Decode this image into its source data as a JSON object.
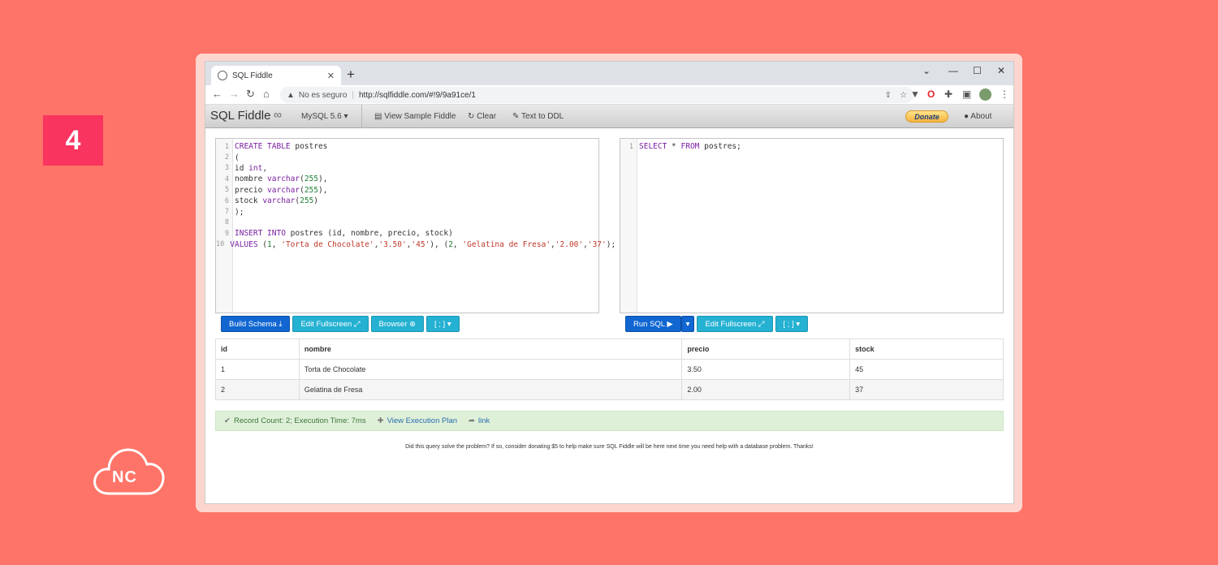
{
  "step": "4",
  "logo": {
    "text": "NC"
  },
  "browser": {
    "tab_title": "SQL Fiddle",
    "tab_close": "✕",
    "new_tab": "+",
    "security_label": "No es seguro",
    "url": "http://sqlfiddle.com/#!9/9a91ce/1",
    "window_controls": {
      "minimize": "—",
      "maximize": "☐",
      "close": "✕",
      "chevron": "⌄"
    }
  },
  "sqlfiddle": {
    "brand": "SQL Fiddle",
    "db_version": "MySQL 5.6",
    "nav": {
      "view_sample": "View Sample Fiddle",
      "clear": "Clear",
      "text_to_ddl": "Text to DDL",
      "donate": "Donate",
      "about": "About"
    },
    "schema_lines": [
      {
        "n": "1",
        "html": "<span class=\"kw\">CREATE TABLE</span> postres"
      },
      {
        "n": "2",
        "html": "("
      },
      {
        "n": "3",
        "html": "id <span class=\"kw\">int</span>,"
      },
      {
        "n": "4",
        "html": "nombre <span class=\"kw\">varchar</span>(<span class=\"num-l\">255</span>),"
      },
      {
        "n": "5",
        "html": "precio <span class=\"kw\">varchar</span>(<span class=\"num-l\">255</span>),"
      },
      {
        "n": "6",
        "html": "stock <span class=\"kw\">varchar</span>(<span class=\"num-l\">255</span>)"
      },
      {
        "n": "7",
        "html": ");"
      },
      {
        "n": "8",
        "html": ""
      },
      {
        "n": "9",
        "html": "<span class=\"kw\">INSERT INTO</span> postres (id, nombre, precio, stock)"
      },
      {
        "n": "10",
        "html": "<span class=\"kw\">VALUES</span> (<span class=\"num-l\">1</span>, <span class=\"str\">'Torta de Chocolate'</span>,<span class=\"str\">'3.50'</span>,<span class=\"str\">'45'</span>), (<span class=\"num-l\">2</span>, <span class=\"str\">'Gelatina de Fresa'</span>,<span class=\"str\">'2.00'</span>,<span class=\"str\">'37'</span>);"
      }
    ],
    "query_lines": [
      {
        "n": "1",
        "html": "<span class=\"kw\">SELECT</span> * <span class=\"kw\">FROM</span> postres;"
      }
    ],
    "schema_buttons": {
      "build": "Build Schema ⤓",
      "edit_fullscreen": "Edit Fullscreen ⤢",
      "browser": "Browser ⊕",
      "terminator": "[ ; ] ▾"
    },
    "query_buttons": {
      "run": "Run SQL ▶",
      "run_caret": "▾",
      "edit_fullscreen": "Edit Fullscreen ⤢",
      "terminator": "[ ; ] ▾"
    },
    "results": {
      "columns": [
        "id",
        "nombre",
        "precio",
        "stock"
      ],
      "rows": [
        [
          "1",
          "Torta de Chocolate",
          "3.50",
          "45"
        ],
        [
          "2",
          "Gelatina de Fresa",
          "2.00",
          "37"
        ]
      ]
    },
    "status": {
      "record_count": "Record Count: 2; Execution Time: 7ms",
      "view_plan": "View Execution Plan",
      "link": "link"
    },
    "footer": "Did this query solve the problem? If so, consider donating $5 to help make sure SQL Fiddle will be here next time you need help with a database problem. Thanks!"
  }
}
